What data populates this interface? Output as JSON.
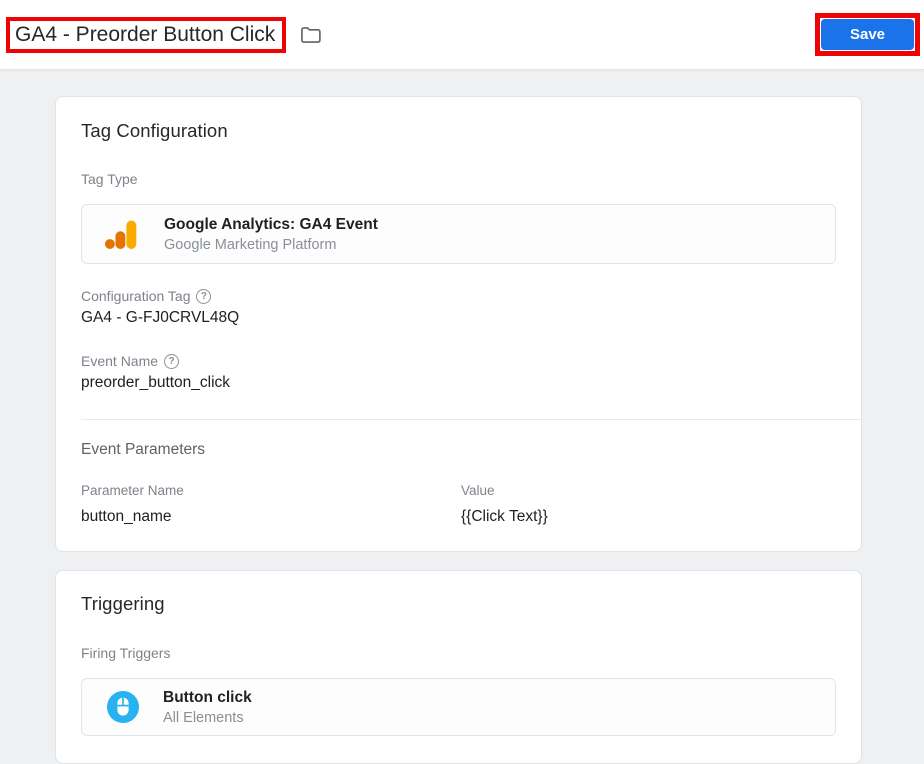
{
  "header": {
    "title": "GA4 - Preorder Button Click",
    "save_label": "Save"
  },
  "tag_configuration": {
    "heading": "Tag Configuration",
    "tag_type_label": "Tag Type",
    "tag_type": {
      "name": "Google Analytics: GA4 Event",
      "vendor": "Google Marketing Platform"
    },
    "configuration_tag_label": "Configuration Tag",
    "configuration_tag_value": "GA4 - G-FJ0CRVL48Q",
    "event_name_label": "Event Name",
    "event_name_value": "preorder_button_click",
    "event_parameters": {
      "heading": "Event Parameters",
      "columns": [
        "Parameter Name",
        "Value"
      ],
      "rows": [
        {
          "name": "button_name",
          "value": "{{Click Text}}"
        }
      ]
    }
  },
  "triggering": {
    "heading": "Triggering",
    "firing_triggers_label": "Firing Triggers",
    "triggers": [
      {
        "name": "Button click",
        "type": "All Elements"
      }
    ]
  },
  "icons": {
    "help_glyph": "?",
    "folder": "folder-outline",
    "tag_type": "google-analytics-logo",
    "trigger": "mouse-in-circle"
  },
  "colors": {
    "accent_blue": "#1a73e8",
    "annotation_red": "#ee0404",
    "ga_amber": "#F9AB00",
    "ga_orange": "#E37400",
    "trigger_blue": "#29b2f0",
    "page_background": "#eef0f2"
  }
}
